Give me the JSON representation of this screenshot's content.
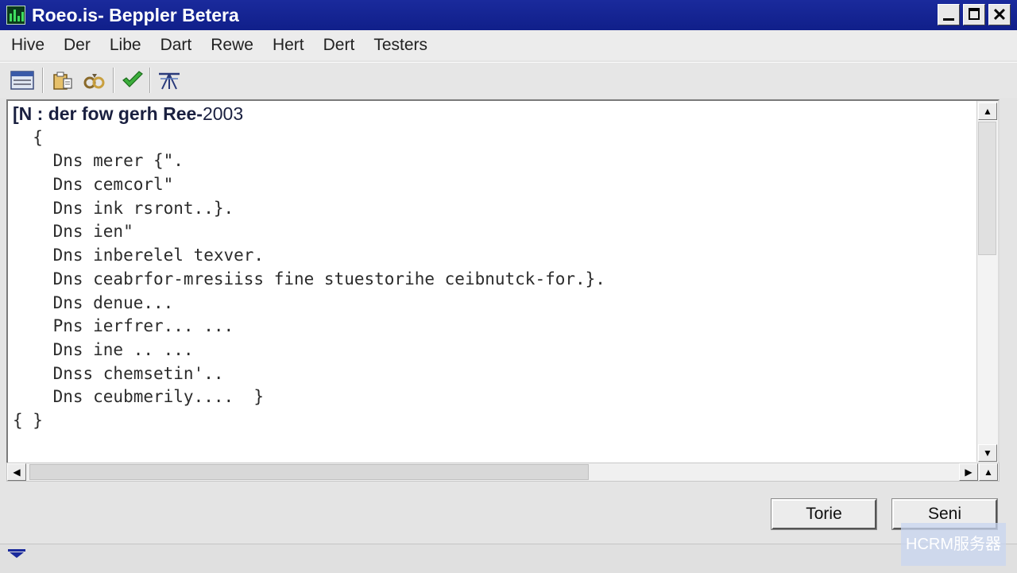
{
  "window": {
    "title": "Roeo.is- Beppler Betera",
    "icons": [
      "app-icon",
      "minimize-icon",
      "maximize-icon",
      "close-icon"
    ]
  },
  "menu": [
    "Hive",
    "Der",
    "Libe",
    "Dart",
    "Rewe",
    "Hert",
    "Dert",
    "Testers"
  ],
  "toolbar": {
    "icons": [
      "window-icon",
      "clipboard-icon",
      "link-icon",
      "checkmark-icon",
      "network-icon"
    ]
  },
  "editor": {
    "header": "[N : der fow gerh Ree-",
    "header_year": "2003",
    "lines": [
      "  {",
      "    Dns merer {\".",
      "    Dns cemcorl\"",
      "    Dns ink rsront..}.",
      "    Dns ien\"",
      "    Dns inberelel texver.",
      "    Dns ceabrfor-mresiiss fine stuestorihe ceibnutck-for.}.",
      "    Dns denue...",
      "    Pns ierfrer... ...",
      "    Dns ine .. ...",
      "    Dnss chemsetin'..",
      "    Dns ceubmerily....  }",
      "{ }"
    ]
  },
  "buttons": {
    "primary": "Torie",
    "secondary": "Seni"
  },
  "watermark": "HCRM服务器"
}
